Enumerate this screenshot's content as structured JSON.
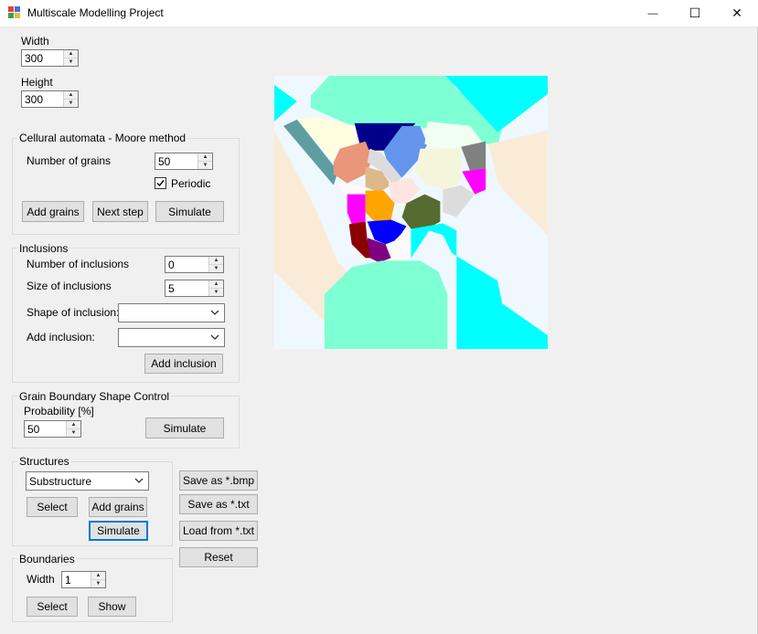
{
  "window": {
    "title": "Multiscale Modelling Project",
    "minimize_glyph": "—",
    "maximize_glyph": "☐",
    "close_glyph": "✕"
  },
  "size": {
    "width_label": "Width",
    "width_value": "300",
    "height_label": "Height",
    "height_value": "300"
  },
  "ca": {
    "group_title": "Cellural automata - Moore method",
    "grains_label": "Number of grains",
    "grains_value": "50",
    "periodic_label": "Periodic",
    "periodic_checked": true,
    "add_grains": "Add grains",
    "next_step": "Next step",
    "simulate": "Simulate"
  },
  "inclusions": {
    "group_title": "Inclusions",
    "number_label": "Number of inclusions",
    "number_value": "0",
    "size_label": "Size of inclusions",
    "size_value": "5",
    "shape_label": "Shape of inclusion:",
    "shape_value": "",
    "add_label": "Add inclusion:",
    "add_value": "",
    "add_button": "Add inclusion"
  },
  "gbsc": {
    "group_title": "Grain Boundary Shape Control",
    "probability_label": "Probability [%]",
    "probability_value": "50",
    "simulate": "Simulate"
  },
  "structures": {
    "group_title": "Structures",
    "type_value": "Substructure",
    "select": "Select",
    "add_grains": "Add grains",
    "simulate": "Simulate"
  },
  "file_buttons": {
    "save_bmp": "Save as *.bmp",
    "save_txt": "Save as *.txt",
    "load_txt": "Load from *.txt",
    "reset": "Reset"
  },
  "boundaries": {
    "group_title": "Boundaries",
    "width_label": "Width",
    "width_value": "1",
    "select": "Select",
    "show": "Show"
  },
  "canvas": {
    "grain_colors": [
      "#f0f8ff",
      "#7fffd4",
      "#00ffff",
      "#faebd7",
      "#5f9ea0",
      "#f5f5dc",
      "#ffffe0",
      "#00008b",
      "#6495ed",
      "#e9967a",
      "#fffafa",
      "#dcdcdc",
      "#f0fff0",
      "#808080",
      "#ff00ff",
      "#deb887",
      "#ffa500",
      "#ffe4e1",
      "#556b2f",
      "#8b0000",
      "#0000ff",
      "#800080",
      "#f0fff4"
    ]
  }
}
